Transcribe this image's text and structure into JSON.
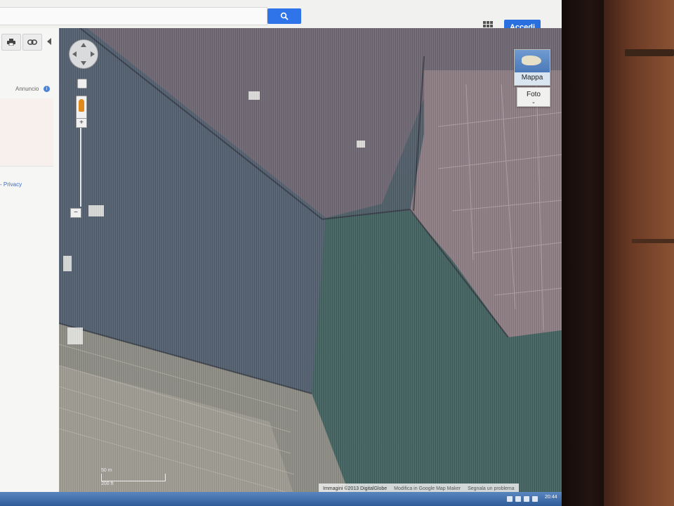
{
  "header": {
    "search_button_icon": "search-icon",
    "apps_icon": "apps-grid-icon",
    "signin_label": "Accedi"
  },
  "left_panel": {
    "print_icon": "printer-icon",
    "link_icon": "link-icon",
    "collapse_icon": "collapse-arrow-icon",
    "ad_label": "Annuncio",
    "ad_info_icon": "info-icon",
    "privacy_link": "- Privacy"
  },
  "map_controls": {
    "pan_icon": "pan-arrows-icon",
    "pegman_icon": "pegman-icon",
    "zoom_in_label": "+",
    "zoom_out_label": "−",
    "map_type_primary": "Mappa",
    "map_type_secondary": "Foto"
  },
  "map_footer": {
    "scale_top": "50 m",
    "scale_bottom": "200 ft",
    "imagery": "Immagini ©2013 DigitalGlobe",
    "edit_link": "Modifica in Google Map Maker",
    "report_link": "Segnala un problema"
  },
  "taskbar": {
    "clock": "20:44"
  },
  "colors": {
    "accent_blue": "#2a6fe0",
    "search_blue": "#2f74e8"
  }
}
